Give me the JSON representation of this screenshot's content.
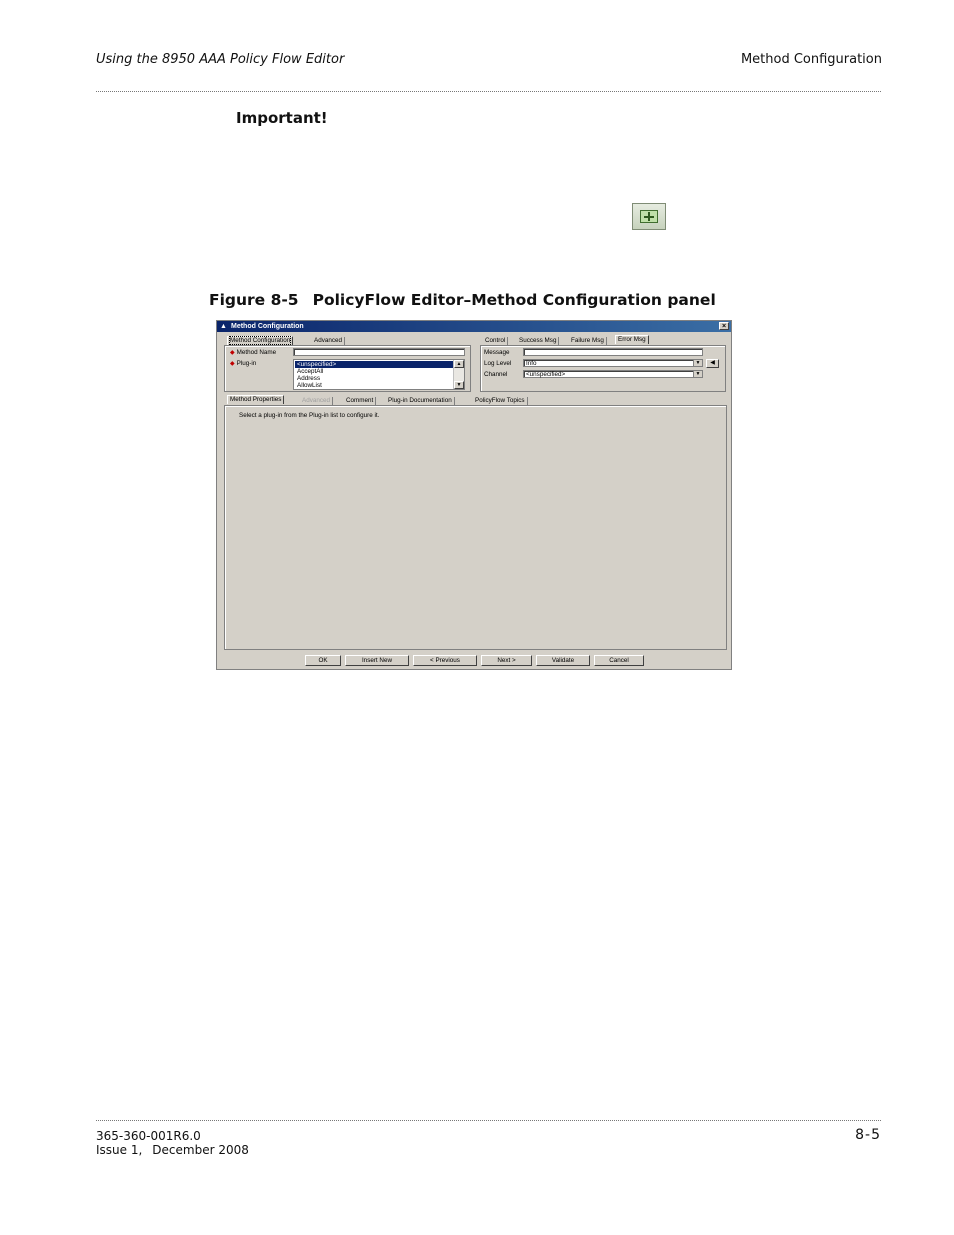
{
  "header": {
    "left": "Using the 8950 AAA Policy Flow Editor",
    "right": "Method Configuration"
  },
  "important_label": "Important!",
  "figure": {
    "number": "Figure 8-5",
    "title": "PolicyFlow Editor–Method Configuration panel"
  },
  "window": {
    "title": "Method Configuration",
    "top_tabs": [
      "Method Configuration",
      "Advanced"
    ],
    "method_name_label": "Method Name",
    "method_name_value": "",
    "plugin_label": "Plug-in",
    "plugin_items": [
      "<unspecified>",
      "AcceptAll",
      "Address",
      "AllowList"
    ],
    "right_tabs": [
      "Control",
      "Success Msg",
      "Failure Msg",
      "Error Msg"
    ],
    "message_label": "Message",
    "message_value": "",
    "log_level_label": "Log Level",
    "log_level_value": "Info",
    "channel_label": "Channel",
    "channel_value": "<unspecified>",
    "bottom_tabs": [
      "Method Properties",
      "Advanced",
      "Comment",
      "Plug-in Documentation",
      "PolicyFlow Topics"
    ],
    "instruction": "Select a plug-in from the Plug-in list to configure it.",
    "buttons": [
      "OK",
      "Insert New",
      "< Previous",
      "Next >",
      "Validate",
      "Cancel"
    ]
  },
  "footer": {
    "doc_number": "365-360-001R6.0",
    "issue": "Issue 1,",
    "date": "December 2008",
    "page": "8-5"
  }
}
